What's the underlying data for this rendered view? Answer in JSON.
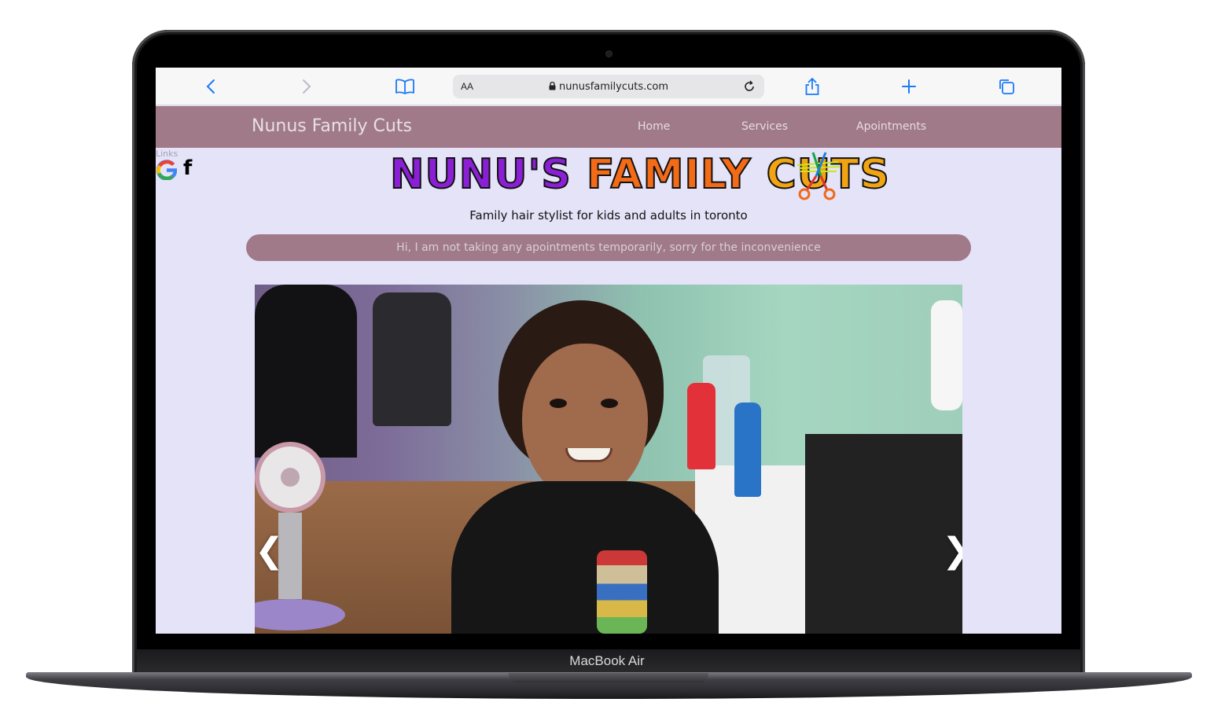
{
  "device": {
    "label": "MacBook Air"
  },
  "browser": {
    "url": "nunusfamilycuts.com",
    "reader_label": "AA"
  },
  "site": {
    "brand": "Nunus Family Cuts",
    "nav": [
      "Home",
      "Services",
      "Apointments"
    ],
    "links_label": "Links",
    "social_icons": [
      "google-icon",
      "facebook-icon"
    ],
    "logo": {
      "parts": [
        {
          "text": "NUNU'S",
          "color": "#8b1fd6"
        },
        {
          "text": "FAMILY",
          "color": "#f36a17"
        },
        {
          "text": "CUTS",
          "color": "#f1a413"
        }
      ]
    },
    "tagline": "Family hair stylist for kids and adults in toronto",
    "notice": "Hi, I am not taking any apointments temporarily, sorry for the inconvenience",
    "slideshow": {
      "prev_label": "❮",
      "next_label": "❯"
    }
  },
  "colors": {
    "nav_bg": "#a07a89",
    "page_bg": "#e4e3f8",
    "accent_blue": "#1a7af8"
  }
}
